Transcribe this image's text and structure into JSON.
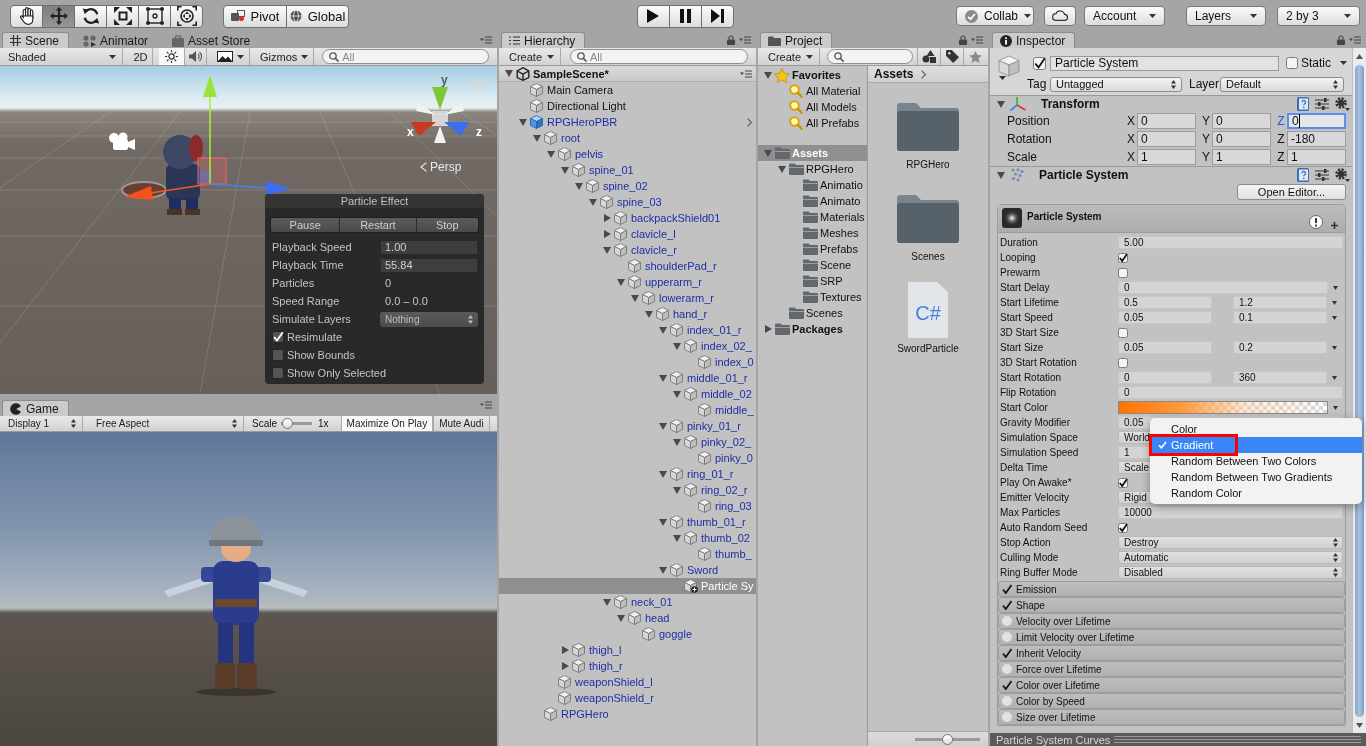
{
  "toolbar": {
    "tools": [
      {
        "kind": "hand",
        "selected": false
      },
      {
        "kind": "move",
        "selected": true
      },
      {
        "kind": "rotate",
        "selected": false
      },
      {
        "kind": "scale",
        "selected": false
      },
      {
        "kind": "rect",
        "selected": false
      },
      {
        "kind": "transform",
        "selected": false
      }
    ],
    "pivot": "Pivot",
    "space": "Global",
    "play_controls": [
      {
        "kind": "play"
      },
      {
        "kind": "pause"
      },
      {
        "kind": "step"
      }
    ],
    "collab": "Collab",
    "account": "Account",
    "layers": "Layers",
    "layout": "2 by 3"
  },
  "scene_panel": {
    "tabs": [
      {
        "label": "Scene",
        "kind": "scene",
        "selected": true
      },
      {
        "label": "Animator",
        "kind": "animator",
        "selected": false
      },
      {
        "label": "Asset Store",
        "kind": "store",
        "selected": false
      }
    ],
    "draw_mode": "Shaded",
    "mode_2d": {
      "label": "2D",
      "on": false
    },
    "lighting_on": true,
    "audio_on": false,
    "gizmos": "Gizmos",
    "search": {
      "placeholder": "All"
    },
    "view": {
      "axis_labels": [
        "y",
        "x",
        "z"
      ],
      "projection": "Persp"
    },
    "particle_effect": {
      "title": "Particle Effect",
      "buttons": [
        "Pause",
        "Restart",
        "Stop"
      ],
      "rows": [
        {
          "label": "Playback Speed",
          "kind": "field",
          "value": "1.00"
        },
        {
          "label": "Playback Time",
          "kind": "field",
          "value": "55.84"
        },
        {
          "label": "Particles",
          "kind": "text",
          "value": "0"
        },
        {
          "label": "Speed Range",
          "kind": "text",
          "value": "0.0 – 0.0"
        },
        {
          "label": "Simulate Layers",
          "kind": "dropdown",
          "value": "Nothing"
        }
      ],
      "options": [
        {
          "label": "Resimulate",
          "checked": true
        },
        {
          "label": "Show Bounds",
          "checked": false
        },
        {
          "label": "Show Only Selected",
          "checked": false
        }
      ]
    }
  },
  "game_panel": {
    "tabs": [
      {
        "label": "Game",
        "kind": "game",
        "selected": true
      }
    ],
    "display": "Display 1",
    "aspect": "Free Aspect",
    "scale": {
      "label": "Scale",
      "level": 0.05,
      "reading": "1x"
    },
    "toggles": [
      {
        "label": "Maximize On Play",
        "on": true
      },
      {
        "label": "Mute Audi",
        "on": false
      }
    ]
  },
  "hierarchy": {
    "tabs": [
      {
        "label": "Hierarchy",
        "selected": true
      }
    ],
    "create": "Create",
    "search": {
      "placeholder": "All"
    },
    "tree": [
      {
        "name": "SampleScene*",
        "kind": "scene",
        "selected": false,
        "expanded": true,
        "children": [
          {
            "name": "Main Camera",
            "kind": "object",
            "selected": false
          },
          {
            "name": "Directional Light",
            "kind": "object",
            "selected": false
          },
          {
            "name": "RPGHeroPBR",
            "kind": "prefab-root",
            "selected": false,
            "expanded": true,
            "children": [
              {
                "name": "root",
                "kind": "prefab-part",
                "selected": false,
                "expanded": true,
                "children": [
                  {
                    "name": "pelvis",
                    "kind": "prefab-part",
                    "selected": false,
                    "expanded": true,
                    "children": [
                      {
                        "name": "spine_01",
                        "kind": "prefab-part",
                        "selected": false,
                        "expanded": true,
                        "children": [
                          {
                            "name": "spine_02",
                            "kind": "prefab-part",
                            "selected": false,
                            "expanded": true,
                            "children": [
                              {
                                "name": "spine_03",
                                "kind": "prefab-part",
                                "selected": false,
                                "expanded": true,
                                "children": [
                                  {
                                    "name": "backpackShield01",
                                    "kind": "prefab-part",
                                    "selected": false,
                                    "expanded": false
                                  },
                                  {
                                    "name": "clavicle_l",
                                    "kind": "prefab-part",
                                    "selected": false,
                                    "expanded": false
                                  },
                                  {
                                    "name": "clavicle_r",
                                    "kind": "prefab-part",
                                    "selected": false,
                                    "expanded": true,
                                    "children": [
                                      {
                                        "name": "shoulderPad_r",
                                        "kind": "prefab-part",
                                        "selected": false
                                      },
                                      {
                                        "name": "upperarm_r",
                                        "kind": "prefab-part",
                                        "selected": false,
                                        "expanded": true,
                                        "children": [
                                          {
                                            "name": "lowerarm_r",
                                            "kind": "prefab-part",
                                            "selected": false,
                                            "expanded": true,
                                            "children": [
                                              {
                                                "name": "hand_r",
                                                "kind": "prefab-part",
                                                "selected": false,
                                                "expanded": true,
                                                "children": [
                                                  {
                                                    "name": "index_01_r",
                                                    "kind": "prefab-part",
                                                    "selected": false,
                                                    "expanded": true,
                                                    "children": [
                                                      {
                                                        "name": "index_02_",
                                                        "kind": "prefab-part",
                                                        "selected": false,
                                                        "expanded": true,
                                                        "children": [
                                                          {
                                                            "name": "index_0",
                                                            "kind": "prefab-part",
                                                            "selected": false
                                                          }
                                                        ]
                                                      }
                                                    ]
                                                  },
                                                  {
                                                    "name": "middle_01_r",
                                                    "kind": "prefab-part",
                                                    "selected": false,
                                                    "expanded": true,
                                                    "children": [
                                                      {
                                                        "name": "middle_02",
                                                        "kind": "prefab-part",
                                                        "selected": false,
                                                        "expanded": true,
                                                        "children": [
                                                          {
                                                            "name": "middle_",
                                                            "kind": "prefab-part",
                                                            "selected": false
                                                          }
                                                        ]
                                                      }
                                                    ]
                                                  },
                                                  {
                                                    "name": "pinky_01_r",
                                                    "kind": "prefab-part",
                                                    "selected": false,
                                                    "expanded": true,
                                                    "children": [
                                                      {
                                                        "name": "pinky_02_",
                                                        "kind": "prefab-part",
                                                        "selected": false,
                                                        "expanded": true,
                                                        "children": [
                                                          {
                                                            "name": "pinky_0",
                                                            "kind": "prefab-part",
                                                            "selected": false
                                                          }
                                                        ]
                                                      }
                                                    ]
                                                  },
                                                  {
                                                    "name": "ring_01_r",
                                                    "kind": "prefab-part",
                                                    "selected": false,
                                                    "expanded": true,
                                                    "children": [
                                                      {
                                                        "name": "ring_02_r",
                                                        "kind": "prefab-part",
                                                        "selected": false,
                                                        "expanded": true,
                                                        "children": [
                                                          {
                                                            "name": "ring_03",
                                                            "kind": "prefab-part",
                                                            "selected": false
                                                          }
                                                        ]
                                                      }
                                                    ]
                                                  },
                                                  {
                                                    "name": "thumb_01_r",
                                                    "kind": "prefab-part",
                                                    "selected": false,
                                                    "expanded": true,
                                                    "children": [
                                                      {
                                                        "name": "thumb_02",
                                                        "kind": "prefab-part",
                                                        "selected": false,
                                                        "expanded": true,
                                                        "children": [
                                                          {
                                                            "name": "thumb_",
                                                            "kind": "prefab-part",
                                                            "selected": false
                                                          }
                                                        ]
                                                      }
                                                    ]
                                                  },
                                                  {
                                                    "name": "Sword",
                                                    "kind": "prefab-part",
                                                    "selected": false,
                                                    "expanded": true,
                                                    "children": [
                                                      {
                                                        "name": "Particle Sy",
                                                        "kind": "particle",
                                                        "selected": true
                                                      }
                                                    ]
                                                  }
                                                ]
                                              }
                                            ]
                                          }
                                        ]
                                      }
                                    ]
                                  },
                                  {
                                    "name": "neck_01",
                                    "kind": "prefab-part",
                                    "selected": false,
                                    "expanded": true,
                                    "children": [
                                      {
                                        "name": "head",
                                        "kind": "prefab-part",
                                        "selected": false,
                                        "expanded": true,
                                        "children": [
                                          {
                                            "name": "goggle",
                                            "kind": "prefab-part",
                                            "selected": false
                                          }
                                        ]
                                      }
                                    ]
                                  }
                                ]
                              }
                            ]
                          }
                        ]
                      },
                      {
                        "name": "thigh_l",
                        "kind": "prefab-part",
                        "selected": false,
                        "expanded": false
                      },
                      {
                        "name": "thigh_r",
                        "kind": "prefab-part",
                        "selected": false,
                        "expanded": false
                      }
                    ]
                  },
                  {
                    "name": "weaponShield_l",
                    "kind": "prefab-part",
                    "selected": false
                  },
                  {
                    "name": "weaponShield_r",
                    "kind": "prefab-part",
                    "selected": false
                  }
                ]
              },
              {
                "name": "RPGHero",
                "kind": "prefab-part",
                "selected": false
              }
            ]
          }
        ]
      }
    ]
  },
  "project": {
    "tabs": [
      {
        "label": "Project",
        "selected": true
      }
    ],
    "create": "Create",
    "sidebar": {
      "favorites": [
        {
          "name": "Favorites",
          "kind": "favorites",
          "selected": false,
          "expanded": true,
          "children": [
            {
              "name": "All Material",
              "kind": "search",
              "selected": false
            },
            {
              "name": "All Models",
              "kind": "search",
              "selected": false
            },
            {
              "name": "All Prefabs",
              "kind": "search",
              "selected": false
            }
          ]
        }
      ],
      "folders": [
        {
          "name": "Assets",
          "kind": "root-folder",
          "selected": true,
          "expanded": true,
          "children": [
            {
              "name": "RPGHero",
              "kind": "folder",
              "selected": false,
              "expanded": true,
              "children": [
                {
                  "name": "Animatio",
                  "kind": "folder",
                  "selected": false
                },
                {
                  "name": "Animato",
                  "kind": "folder",
                  "selected": false
                },
                {
                  "name": "Materials",
                  "kind": "folder",
                  "selected": false
                },
                {
                  "name": "Meshes",
                  "kind": "folder",
                  "selected": false
                },
                {
                  "name": "Prefabs",
                  "kind": "folder",
                  "selected": false
                },
                {
                  "name": "Scene",
                  "kind": "folder",
                  "selected": false
                },
                {
                  "name": "SRP",
                  "kind": "folder",
                  "selected": false
                },
                {
                  "name": "Textures",
                  "kind": "folder",
                  "selected": false
                }
              ]
            },
            {
              "name": "Scenes",
              "kind": "folder",
              "selected": false
            }
          ]
        },
        {
          "name": "Packages",
          "kind": "root-folder",
          "selected": false,
          "expanded": false
        }
      ]
    },
    "breadcrumb": "Assets",
    "assets": [
      {
        "name": "RPGHero",
        "kind": "folder",
        "selected": false
      },
      {
        "name": "Scenes",
        "kind": "folder",
        "selected": false
      },
      {
        "name": "SwordParticle",
        "kind": "script",
        "badge": "C#",
        "selected": false
      }
    ],
    "icon_size": {
      "level": 0.5
    }
  },
  "inspector": {
    "tabs": [
      {
        "label": "Inspector",
        "selected": true
      }
    ],
    "object": {
      "active": true,
      "name": "Particle System",
      "static": false,
      "static_label": "Static",
      "tag_label": "Tag",
      "tag": "Untagged",
      "layer_label": "Layer",
      "layer": "Default"
    },
    "transform": {
      "title": "Transform",
      "expanded": true,
      "rows": [
        {
          "label": "Position",
          "axes": [
            {
              "axis": "X",
              "value": "0",
              "focused": false
            },
            {
              "axis": "Y",
              "value": "0",
              "focused": false
            },
            {
              "axis": "Z",
              "value": "0",
              "focused": true
            }
          ]
        },
        {
          "label": "Rotation",
          "axes": [
            {
              "axis": "X",
              "value": "0",
              "focused": false
            },
            {
              "axis": "Y",
              "value": "0",
              "focused": false
            },
            {
              "axis": "Z",
              "value": "-180",
              "focused": false
            }
          ]
        },
        {
          "label": "Scale",
          "axes": [
            {
              "axis": "X",
              "value": "1",
              "focused": false
            },
            {
              "axis": "Y",
              "value": "1",
              "focused": false
            },
            {
              "axis": "Z",
              "value": "1",
              "focused": false
            }
          ]
        }
      ]
    },
    "particle_system": {
      "title": "Particle System",
      "expanded": true,
      "open_editor": "Open Editor...",
      "module_title": "Particle System",
      "properties": [
        {
          "label": "Duration",
          "kind": "field",
          "value": "5.00"
        },
        {
          "label": "Looping",
          "kind": "checkbox",
          "checked": true
        },
        {
          "label": "Prewarm",
          "kind": "checkbox",
          "checked": false
        },
        {
          "label": "Start Delay",
          "kind": "curve",
          "value": "0"
        },
        {
          "label": "Start Lifetime",
          "kind": "range",
          "values": [
            "0.5",
            "1.2"
          ]
        },
        {
          "label": "Start Speed",
          "kind": "range",
          "values": [
            "0.05",
            "0.1"
          ]
        },
        {
          "label": "3D Start Size",
          "kind": "checkbox",
          "checked": false
        },
        {
          "label": "Start Size",
          "kind": "range",
          "values": [
            "0.05",
            "0.2"
          ]
        },
        {
          "label": "3D Start Rotation",
          "kind": "checkbox",
          "checked": false
        },
        {
          "label": "Start Rotation",
          "kind": "range",
          "values": [
            "0",
            "360"
          ]
        },
        {
          "label": "Flip Rotation",
          "kind": "field",
          "value": "0"
        },
        {
          "label": "Start Color",
          "kind": "gradient"
        },
        {
          "label": "Gravity Modifier",
          "kind": "field",
          "value": "0.05"
        },
        {
          "label": "Simulation Space",
          "kind": "dropdown",
          "value": "World"
        },
        {
          "label": "Simulation Speed",
          "kind": "field",
          "value": "1"
        },
        {
          "label": "Delta Time",
          "kind": "dropdown",
          "value": "Scale"
        },
        {
          "label": "Play On Awake*",
          "kind": "checkbox",
          "checked": true
        },
        {
          "label": "Emitter Velocity",
          "kind": "dropdown",
          "value": "Rigid"
        },
        {
          "label": "Max Particles",
          "kind": "field",
          "value": "10000"
        },
        {
          "label": "Auto Random Seed",
          "kind": "checkbox",
          "checked": true
        },
        {
          "label": "Stop Action",
          "kind": "dropdown",
          "value": "Destroy"
        },
        {
          "label": "Culling Mode",
          "kind": "dropdown",
          "value": "Automatic"
        },
        {
          "label": "Ring Buffer Mode",
          "kind": "dropdown",
          "value": "Disabled"
        }
      ],
      "modules": [
        {
          "label": "Emission",
          "enabled": true
        },
        {
          "label": "Shape",
          "enabled": true
        },
        {
          "label": "Velocity over Lifetime",
          "enabled": false
        },
        {
          "label": "Limit Velocity over Lifetime",
          "enabled": false
        },
        {
          "label": "Inherit Velocity",
          "enabled": true
        },
        {
          "label": "Force over Lifetime",
          "enabled": false
        },
        {
          "label": "Color over Lifetime",
          "enabled": true
        },
        {
          "label": "Color by Speed",
          "enabled": false
        },
        {
          "label": "Size over Lifetime",
          "enabled": false
        }
      ]
    },
    "popup_menu": {
      "items": [
        {
          "label": "Color",
          "selected": false,
          "annotated": false
        },
        {
          "label": "Gradient",
          "selected": true,
          "annotated": true
        },
        {
          "label": "Random Between Two Colors",
          "selected": false,
          "annotated": false
        },
        {
          "label": "Random Between Two Gradients",
          "selected": false,
          "annotated": false
        },
        {
          "label": "Random Color",
          "selected": false,
          "annotated": false
        }
      ]
    },
    "curves_bar": "Particle System Curves"
  }
}
